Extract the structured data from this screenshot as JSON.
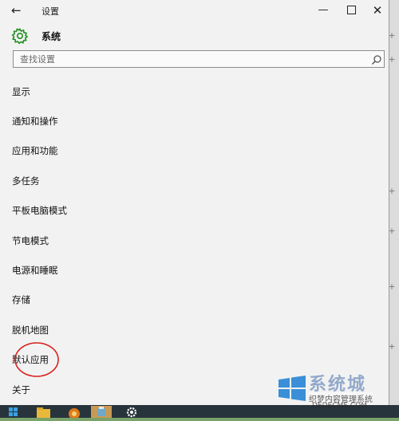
{
  "window": {
    "back_glyph": "←",
    "title": "设置",
    "min_glyph": "—",
    "close_glyph": "✕"
  },
  "section": {
    "title": "系统"
  },
  "search": {
    "placeholder": "查找设置",
    "value": ""
  },
  "menu": {
    "items": [
      {
        "label": "显示"
      },
      {
        "label": "通知和操作"
      },
      {
        "label": "应用和功能"
      },
      {
        "label": "多任务"
      },
      {
        "label": "平板电脑模式"
      },
      {
        "label": "节电模式"
      },
      {
        "label": "电源和睡眠"
      },
      {
        "label": "存储"
      },
      {
        "label": "脱机地图"
      },
      {
        "label": "默认应用",
        "highlighted": true
      },
      {
        "label": "关于"
      }
    ]
  },
  "taskbar": {
    "icons": [
      "start-icon",
      "file-explorer-icon",
      "wifi-icon",
      "store-icon",
      "settings-icon"
    ]
  },
  "watermark": {
    "title": "系统城",
    "subtitle": "织梦内容管理系统",
    "site": "DEDECMS.COM"
  },
  "colors": {
    "window_bg": "#f2f2f2",
    "accent_green": "#1f8f1f",
    "highlight_red": "#d9231f",
    "taskbar_bg": "#28343c"
  }
}
